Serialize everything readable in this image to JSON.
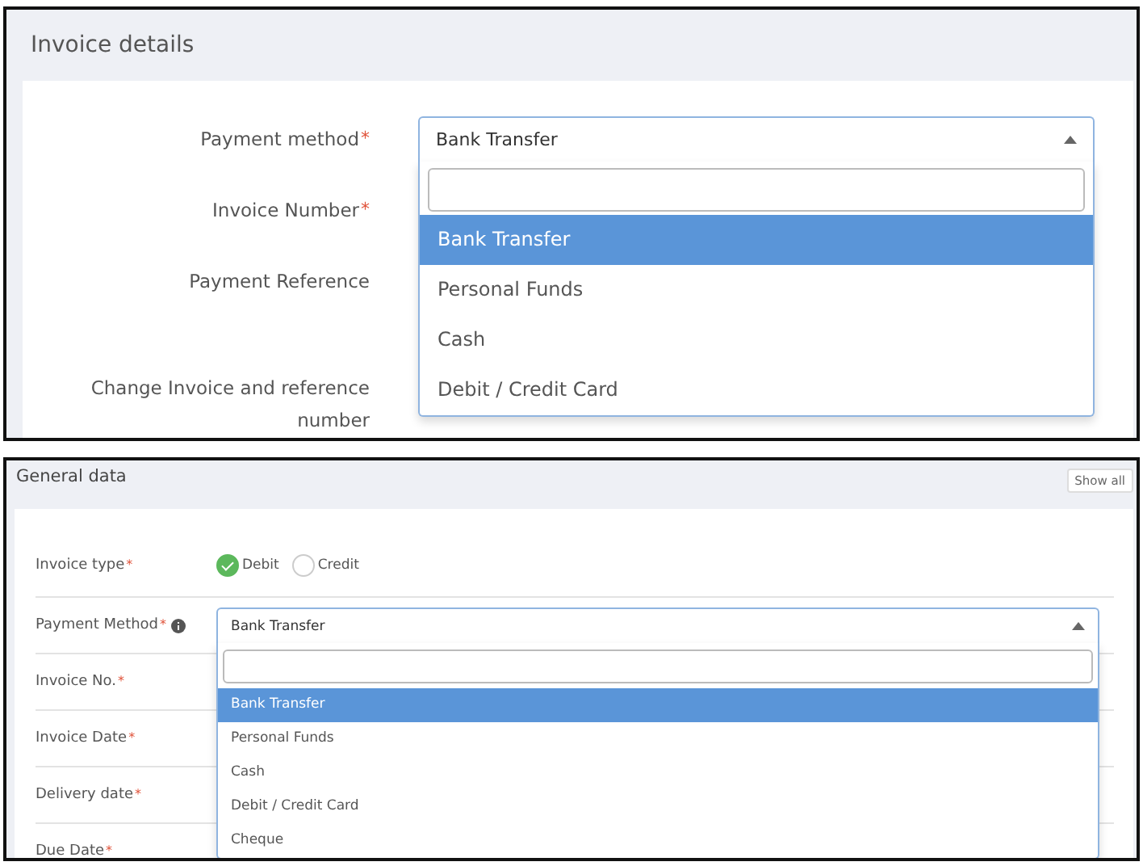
{
  "invoice_details": {
    "title": "Invoice details",
    "fields": [
      {
        "label": "Payment method",
        "marker": "*",
        "kind": "select",
        "value": "Bank Transfer",
        "options": [
          {
            "label": "Bank Transfer",
            "selected": true
          },
          {
            "label": "Personal Funds",
            "selected": false
          },
          {
            "label": "Cash",
            "selected": false
          },
          {
            "label": "Debit / Credit Card",
            "selected": false
          }
        ]
      },
      {
        "label": "Invoice Number",
        "marker": "*",
        "kind": "hidden"
      },
      {
        "label": "Payment Reference",
        "kind": "hidden"
      },
      {
        "label": "Change Invoice and reference number",
        "kind": "hidden"
      }
    ]
  },
  "general_data": {
    "title": "General data",
    "button": "Show all",
    "fields": [
      {
        "label": "Invoice type",
        "marker": "*",
        "kind": "radio",
        "options": [
          {
            "label": "Debit",
            "selected": true
          },
          {
            "label": "Credit",
            "selected": false
          }
        ]
      },
      {
        "label": "Payment Method",
        "marker": "*",
        "info": true,
        "kind": "select",
        "value": "Bank Transfer",
        "options": [
          {
            "label": "Bank Transfer",
            "selected": true
          },
          {
            "label": "Personal Funds",
            "selected": false
          },
          {
            "label": "Cash",
            "selected": false
          },
          {
            "label": "Debit / Credit Card",
            "selected": false
          },
          {
            "label": "Cheque",
            "selected": false
          }
        ]
      },
      {
        "label": "Invoice No.",
        "marker": "*",
        "kind": "hidden"
      },
      {
        "label": "Invoice Date",
        "marker": "*",
        "kind": "hidden"
      },
      {
        "label": "Delivery date",
        "marker": "*",
        "kind": "hidden"
      },
      {
        "label": "Due Date",
        "marker": "*",
        "kind": "hidden"
      }
    ]
  }
}
